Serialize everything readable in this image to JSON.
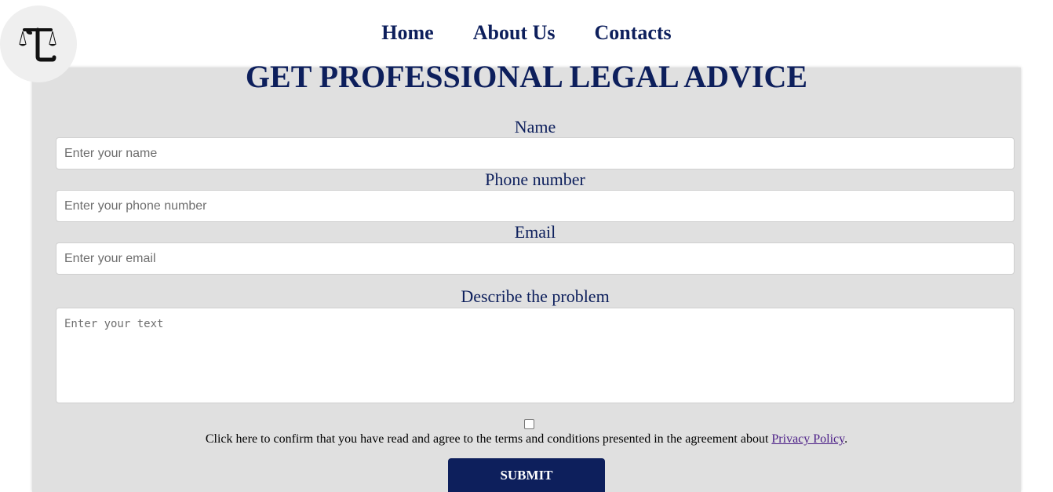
{
  "header": {
    "logo_icon": "scales-of-justice-T-logo",
    "nav": {
      "home": "Home",
      "about": "About Us",
      "contacts": "Contacts"
    }
  },
  "form": {
    "title": "GET PROFESSIONAL LEGAL ADVICE",
    "name_label": "Name",
    "name_placeholder": "Enter your name",
    "phone_label": "Phone number",
    "phone_placeholder": "Enter your phone number",
    "email_label": "Email",
    "email_placeholder": "Enter your email",
    "problem_label": "Describe the problem",
    "problem_placeholder": "Enter your text",
    "agree_text": "Click here to confirm that you have read and agree to the terms and conditions presented in the agreement about ",
    "privacy_link": "Privacy Policy",
    "agree_suffix": ".",
    "submit_label": "SUBMIT",
    "checkbox_checked": false
  },
  "colors": {
    "brand_navy": "#0d1f5c",
    "panel_bg": "#e0e0e0",
    "link_purple": "#4b1e87"
  }
}
